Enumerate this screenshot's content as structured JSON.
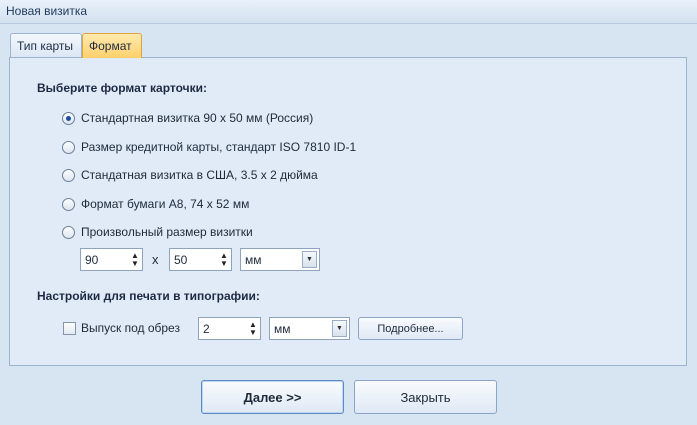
{
  "window": {
    "title": "Новая визитка"
  },
  "tabs": [
    {
      "label": "Тип карты"
    },
    {
      "label": "Формат"
    }
  ],
  "format_section": {
    "title": "Выберите формат карточки:",
    "options": [
      {
        "label": "Стандартная визитка 90 х 50 мм (Россия)",
        "checked": true
      },
      {
        "label": "Размер кредитной карты, стандарт ISO 7810 ID-1",
        "checked": false
      },
      {
        "label": "Стандатная визитка в США, 3.5 х 2 дюйма",
        "checked": false
      },
      {
        "label": "Формат бумаги A8, 74 х 52 мм",
        "checked": false
      },
      {
        "label": "Произвольный размер визитки",
        "checked": false
      }
    ],
    "width_value": "90",
    "separator": "x",
    "height_value": "50",
    "unit_value": "мм"
  },
  "print_section": {
    "title": "Настройки для печати в типографии:",
    "bleed_label": "Выпуск под обрез",
    "bleed_value": "2",
    "bleed_unit": "мм",
    "details_label": "Подробнее..."
  },
  "buttons": {
    "next_label": "Далее >>",
    "close_label": "Закрыть"
  }
}
